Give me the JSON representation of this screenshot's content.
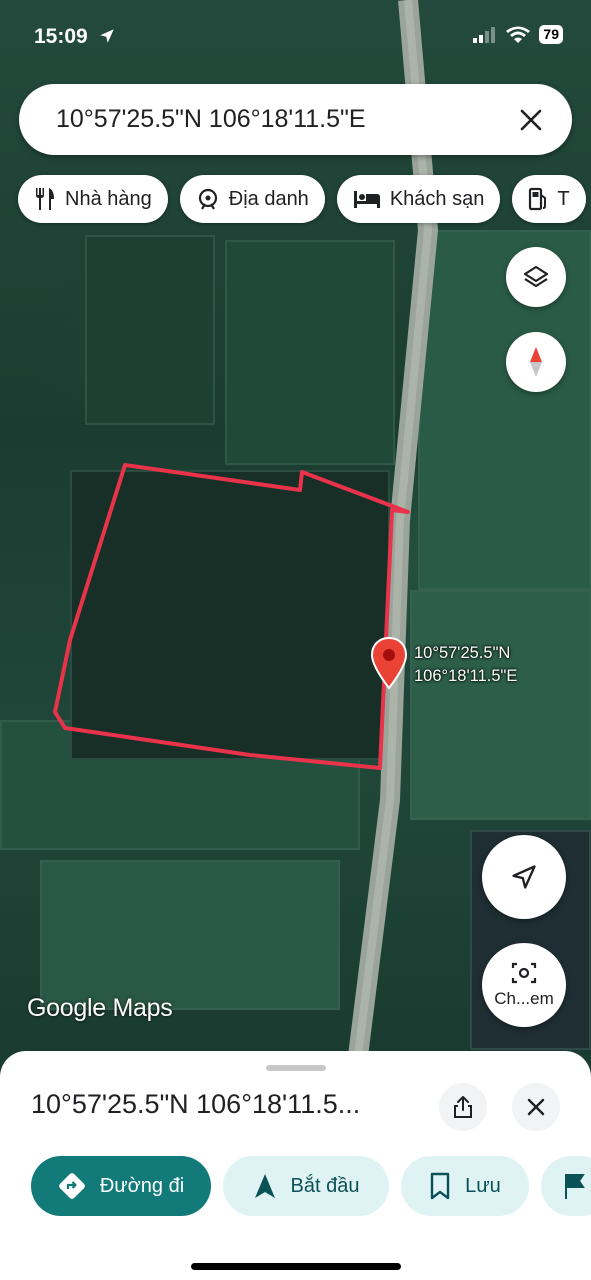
{
  "status_bar": {
    "time": "15:09",
    "battery": "79"
  },
  "search": {
    "query": "10°57'25.5\"N 106°18'11.5\"E"
  },
  "chips": [
    {
      "label": "Nhà hàng",
      "icon": "restaurant-icon"
    },
    {
      "label": "Địa danh",
      "icon": "landmark-icon"
    },
    {
      "label": "Khách sạn",
      "icon": "hotel-icon"
    },
    {
      "label": "T",
      "icon": "gas-station-icon"
    }
  ],
  "map": {
    "attribution": "Google Maps",
    "pin_label_lat": "10°57'25.5\"N",
    "pin_label_lng": "106°18'11.5\"E",
    "street_view_label": "Ch...em",
    "boundary_color": "#e8334a",
    "pin_color": "#ea4335"
  },
  "sheet": {
    "title": "10°57'25.5\"N 106°18'11.5...",
    "actions": [
      {
        "label": "Đường đi",
        "icon": "directions-icon"
      },
      {
        "label": "Bắt đầu",
        "icon": "navigation-arrow-icon"
      },
      {
        "label": "Lưu",
        "icon": "bookmark-icon"
      },
      {
        "label": "",
        "icon": "flag-icon"
      }
    ]
  },
  "colors": {
    "accent": "#137a7a",
    "accent_light": "#dff3f5"
  }
}
